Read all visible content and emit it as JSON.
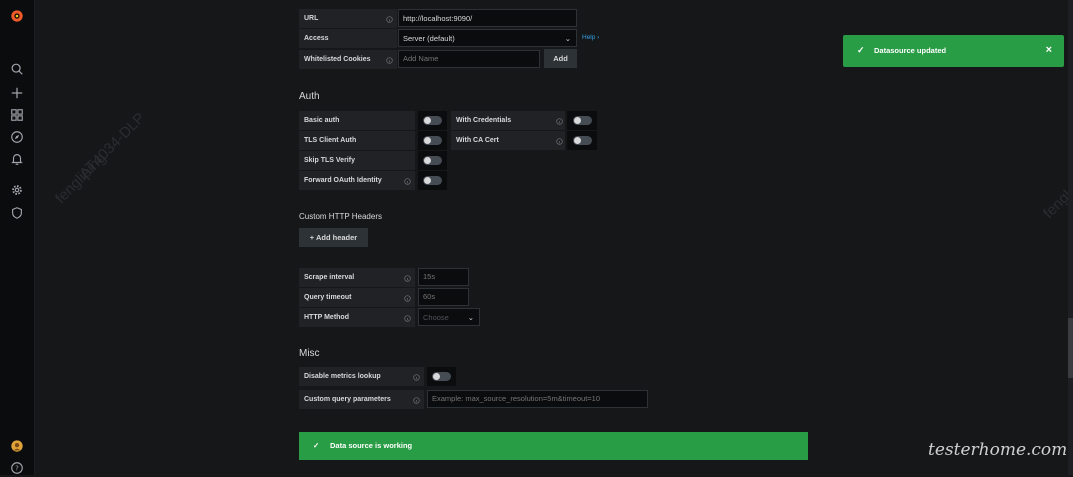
{
  "colors": {
    "success": "#299c46",
    "link": "#33a2e5",
    "sidebar_bg": "#0b0c0e",
    "page_bg": "#161719"
  },
  "http": {
    "url_label": "URL",
    "url_value": "http://localhost:9090/",
    "access_label": "Access",
    "access_value": "Server (default)",
    "help_label": "Help",
    "cookies_label": "Whitelisted Cookies",
    "cookies_placeholder": "Add Name",
    "add_button": "Add"
  },
  "auth": {
    "title": "Auth",
    "basic_auth": "Basic auth",
    "with_credentials": "With Credentials",
    "tls_client_auth": "TLS Client Auth",
    "with_ca_cert": "With CA Cert",
    "skip_tls_verify": "Skip TLS Verify",
    "forward_oauth": "Forward OAuth Identity"
  },
  "headers": {
    "title": "Custom HTTP Headers",
    "add_header": "+ Add header"
  },
  "prometheus": {
    "scrape_label": "Scrape interval",
    "scrape_placeholder": "15s",
    "timeout_label": "Query timeout",
    "timeout_placeholder": "60s",
    "method_label": "HTTP Method",
    "method_placeholder": "Choose"
  },
  "misc": {
    "title": "Misc",
    "disable_lookup": "Disable metrics lookup",
    "custom_params": "Custom query parameters",
    "custom_params_placeholder": "Example: max_source_resolution=5m&timeout=10"
  },
  "toast": {
    "message": "Datasource updated",
    "close": "×"
  },
  "banner": {
    "message": "Data source is working"
  },
  "watermarks": [
    "fengliping",
    "AT4034-DLP",
    "fengl"
  ],
  "brand": "testerhome.com",
  "icons": {
    "logo": "grafana-logo-icon",
    "search": "search-icon",
    "create": "plus-icon",
    "dashboards": "dashboards-icon",
    "explore": "compass-icon",
    "alerting": "bell-icon",
    "config": "gear-icon",
    "shield": "shield-icon",
    "avatar": "avatar-icon",
    "help": "help-icon"
  }
}
